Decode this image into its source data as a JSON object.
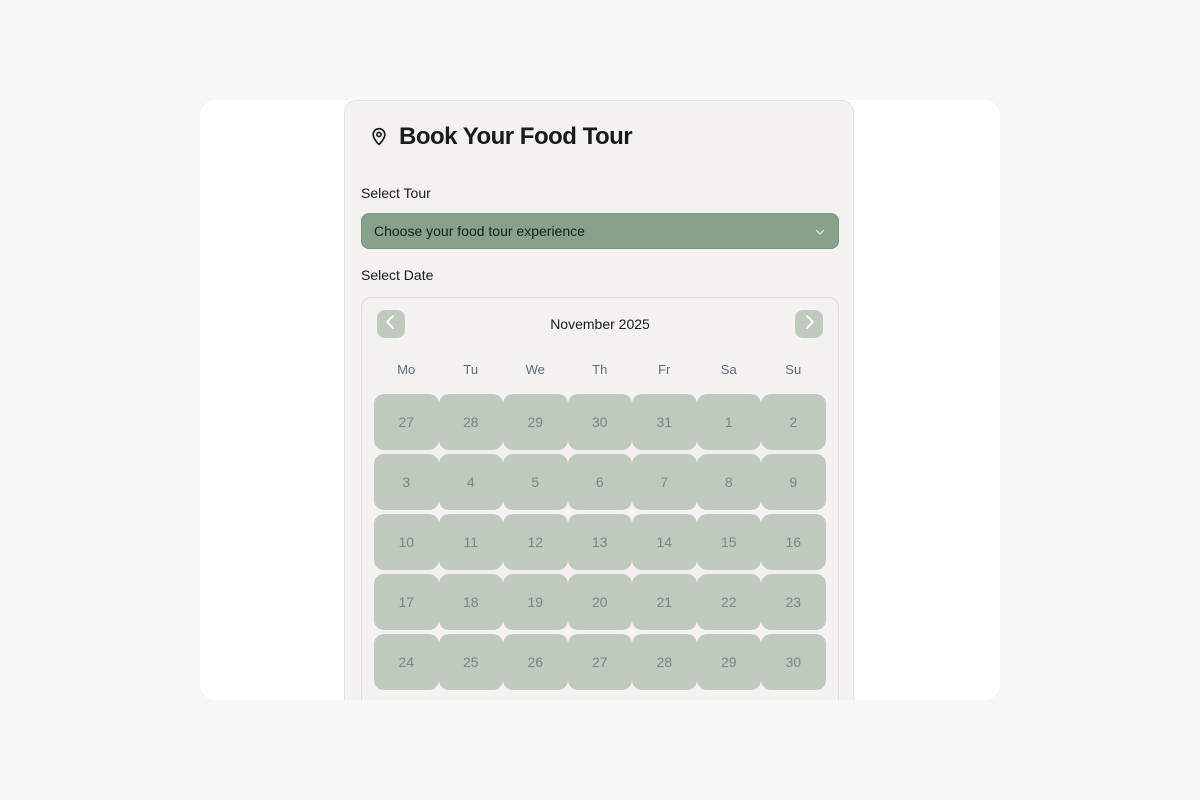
{
  "header": {
    "title": "Book Your Food Tour",
    "icon": "map-pin-icon"
  },
  "tour": {
    "label": "Select Tour",
    "placeholder": "Choose your food tour experience"
  },
  "date": {
    "label": "Select Date"
  },
  "calendar": {
    "month": "November 2025",
    "weekdays": [
      "Mo",
      "Tu",
      "We",
      "Th",
      "Fr",
      "Sa",
      "Su"
    ],
    "days": [
      "27",
      "28",
      "29",
      "30",
      "31",
      "1",
      "2",
      "3",
      "4",
      "5",
      "6",
      "7",
      "8",
      "9",
      "10",
      "11",
      "12",
      "13",
      "14",
      "15",
      "16",
      "17",
      "18",
      "19",
      "20",
      "21",
      "22",
      "23",
      "24",
      "25",
      "26",
      "27",
      "28",
      "29",
      "30"
    ]
  },
  "colors": {
    "select_bg": "#87a18a",
    "day_bg": "#bfc9be",
    "day_text": "#7d8580"
  }
}
